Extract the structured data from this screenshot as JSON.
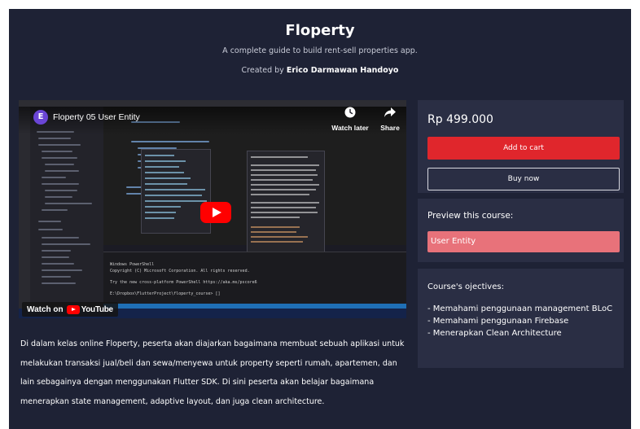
{
  "header": {
    "title": "Floperty",
    "subtitle": "A complete guide to build rent-sell properties app.",
    "created_by_prefix": "Created by",
    "author": "Erico Darmawan Handoyo"
  },
  "video": {
    "channel_initial": "E",
    "title": "Floperty 05 User Entity",
    "watch_later_label": "Watch later",
    "share_label": "Share",
    "watch_on_label": "Watch on",
    "youtube_label": "YouTube",
    "terminal_lines": [
      "Windows PowerShell",
      "Copyright (C) Microsoft Corporation. All rights reserved.",
      "",
      "Try the new cross-platform PowerShell https://aka.ms/pscore6",
      "",
      "E:\\Dropbox\\FlutterProject\\floperty_course> []"
    ]
  },
  "description": "Di dalam kelas online Floperty, peserta akan diajarkan bagaimana membuat sebuah aplikasi untuk melakukan transaksi jual/beli dan sewa/menyewa untuk property seperti rumah, apartemen, dan lain sebagainya dengan menggunakan Flutter SDK. Di sini peserta akan belajar bagaimana menerapkan state management, adaptive layout, dan juga clean architecture.",
  "purchase": {
    "price": "Rp 499.000",
    "add_to_cart_label": "Add to cart",
    "buy_now_label": "Buy now"
  },
  "preview": {
    "title": "Preview this course:",
    "items": [
      "User Entity"
    ]
  },
  "objectives": {
    "title": "Course's ojectives:",
    "items": [
      "- Memahami penggunaan management BLoC",
      "- Memahami penggunaan Firebase",
      "- Menerapkan Clean Architecture"
    ]
  },
  "colors": {
    "page_bg": "#1e2235",
    "panel_bg": "#2a2e44",
    "cart_button": "#e0262c",
    "preview_item": "#e8727a",
    "youtube_red": "#ff0000"
  }
}
